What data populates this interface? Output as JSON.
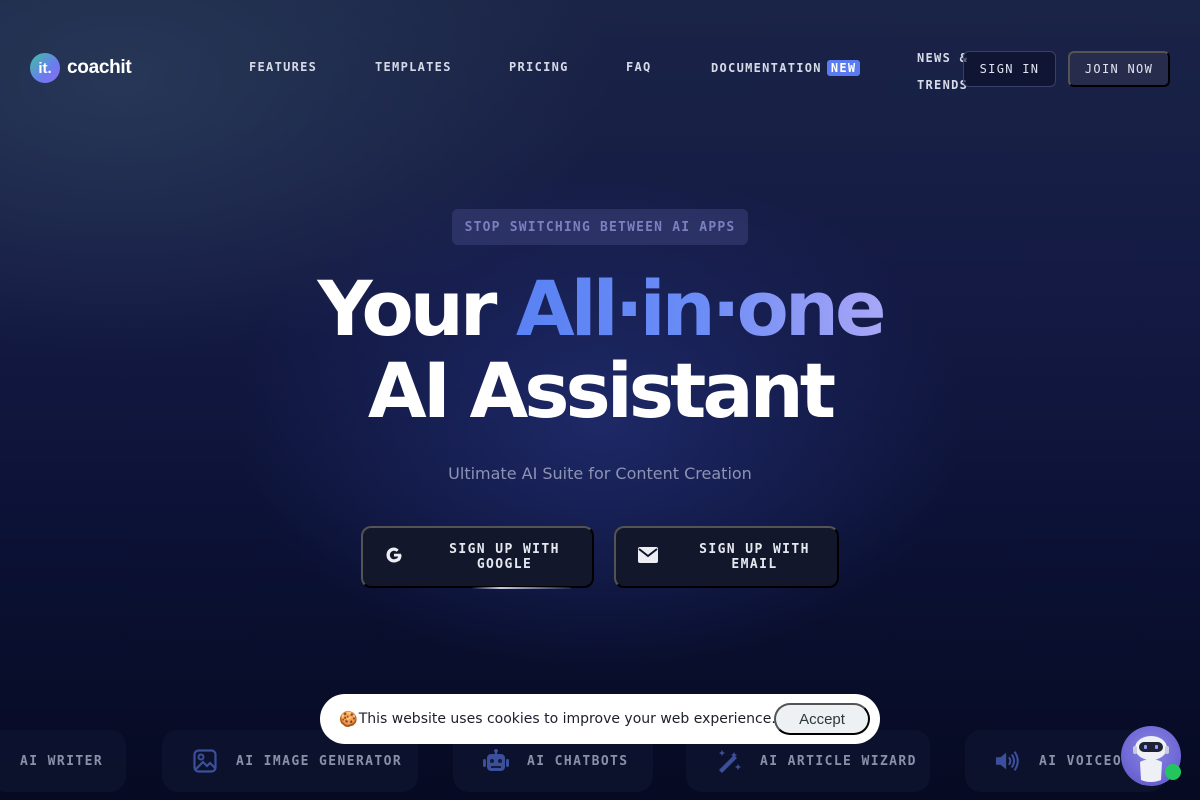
{
  "header": {
    "logo_badge": "it.",
    "logo_text": "coachit",
    "nav": [
      {
        "label": "FEATURES"
      },
      {
        "label": "TEMPLATES"
      },
      {
        "label": "PRICING"
      },
      {
        "label": "FAQ"
      },
      {
        "label": "DOCUMENTATION",
        "badge": "NEW"
      }
    ],
    "news_line1": "NEWS &",
    "news_line2": "TRENDS",
    "sign_in": "SIGN IN",
    "join_now": "JOIN NOW"
  },
  "hero": {
    "eyebrow": "STOP SWITCHING BETWEEN AI APPS",
    "headline_white_1": "Your ",
    "headline_gradient": "All·in·one",
    "headline_line2": "AI Assistant",
    "subtitle": "Ultimate AI Suite for Content Creation",
    "cta_google": "SIGN UP WITH GOOGLE",
    "cta_email": "SIGN UP WITH EMAIL"
  },
  "tools": [
    {
      "label": "AI WRITER",
      "icon": "none"
    },
    {
      "label": "AI IMAGE GENERATOR",
      "icon": "image-icon"
    },
    {
      "label": "AI CHATBOTS",
      "icon": "robot-icon"
    },
    {
      "label": "AI ARTICLE WIZARD",
      "icon": "magic-wand-icon"
    },
    {
      "label": "AI VOICEOVER",
      "icon": "speaker-icon"
    }
  ],
  "cookie": {
    "emoji": "🍪",
    "text": "This website uses cookies to improve your web experience.",
    "accept": "Accept"
  },
  "colors": {
    "accent": "#5b7cf0",
    "gradient_end": "#a9a6f6",
    "online": "#22c55e"
  }
}
